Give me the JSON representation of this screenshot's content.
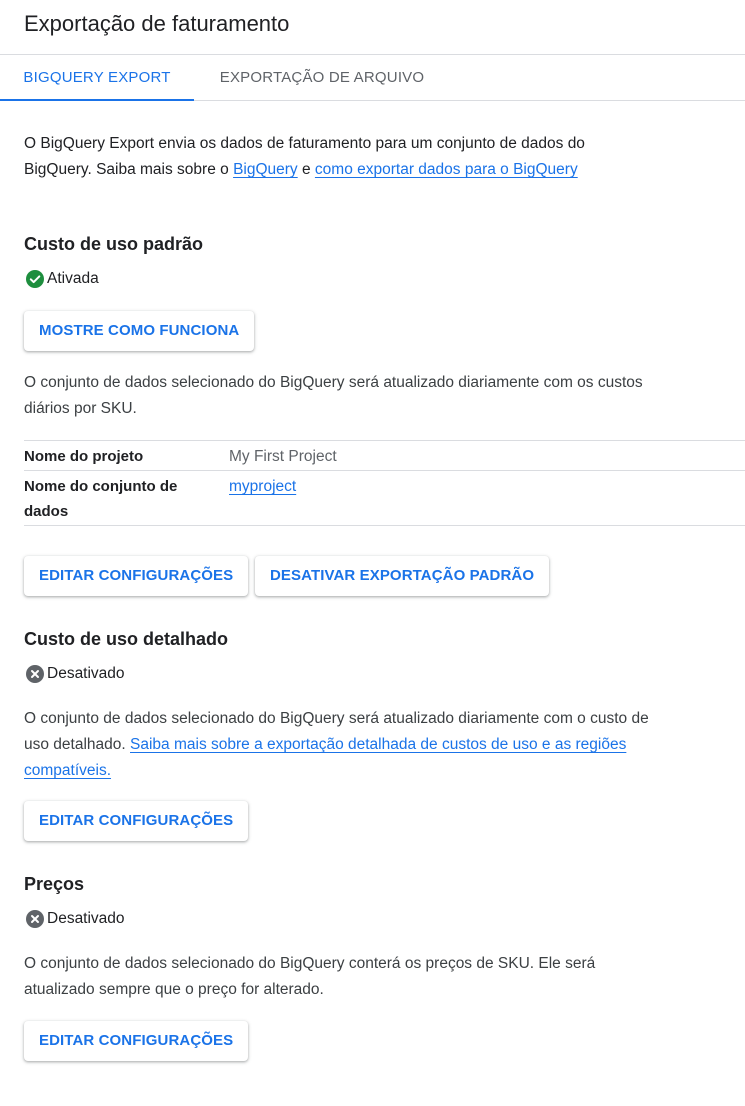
{
  "header": {
    "title": "Exportação de faturamento"
  },
  "tabs": [
    {
      "label": "BIGQUERY EXPORT",
      "active": true
    },
    {
      "label": "EXPORTAÇÃO DE ARQUIVO",
      "active": false
    }
  ],
  "intro": {
    "text_before": "O BigQuery Export envia os dados de faturamento para um conjunto de dados do BigQuery. Saiba mais sobre o ",
    "link1": "BigQuery",
    "text_mid": " e ",
    "link2": "como exportar dados para o BigQuery"
  },
  "standard": {
    "title": "Custo de uso padrão",
    "status": "Ativada",
    "how_button": "MOSTRE COMO FUNCIONA",
    "description": "O conjunto de dados selecionado do BigQuery será atualizado diariamente com os custos diários por SKU.",
    "table": [
      {
        "key": "Nome do projeto",
        "value": "My First Project"
      },
      {
        "key": "Nome do conjunto de dados",
        "value": "myproject"
      }
    ],
    "edit_button": "EDITAR CONFIGURAÇÕES",
    "disable_button": "DESATIVAR EXPORTAÇÃO PADRÃO"
  },
  "detailed": {
    "title": "Custo de uso detalhado",
    "status": "Desativado",
    "description": "O conjunto de dados selecionado do BigQuery será atualizado diariamente com o custo de uso detalhado. ",
    "link": "Saiba mais sobre a exportação detalhada de custos de uso e as regiões compatíveis.",
    "edit_button": "EDITAR CONFIGURAÇÕES"
  },
  "pricing": {
    "title": "Preços",
    "status": "Desativado",
    "description": "O conjunto de dados selecionado do BigQuery conterá os preços de SKU. Ele será atualizado sempre que o preço for alterado.",
    "edit_button": "EDITAR CONFIGURAÇÕES"
  },
  "colors": {
    "accent": "#1a73e8",
    "success": "#1e8e3e",
    "disabled": "#5f6368"
  },
  "icons": {
    "enabled": "check-circle-icon",
    "disabled": "cancel-circle-icon"
  }
}
